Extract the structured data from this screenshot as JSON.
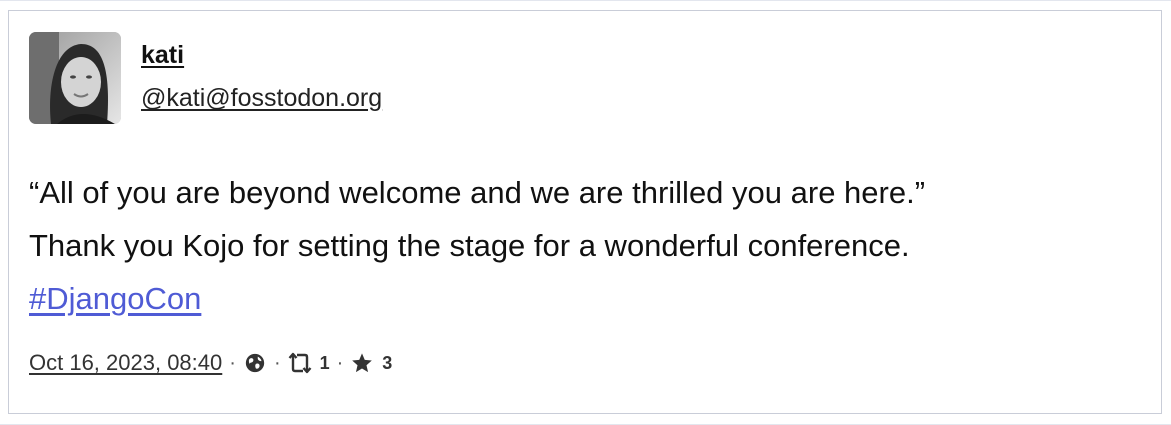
{
  "author": {
    "display_name": "kati",
    "handle": "@kati@fosstodon.org"
  },
  "post": {
    "line1": "“All of you are beyond welcome and we are thrilled you are here.”",
    "line2": "Thank you Kojo for setting the stage for a wonderful conference.",
    "hashtag": "#DjangoCon"
  },
  "meta": {
    "timestamp": "Oct 16, 2023, 08:40",
    "separator": "·",
    "visibility_icon": "globe-icon",
    "boost_icon": "boost-icon",
    "boost_count": "1",
    "favourite_icon": "star-icon",
    "favourite_count": "3"
  },
  "colors": {
    "hashtag": "#4f5bd5",
    "border": "#c9cdd8",
    "text": "#111111"
  }
}
